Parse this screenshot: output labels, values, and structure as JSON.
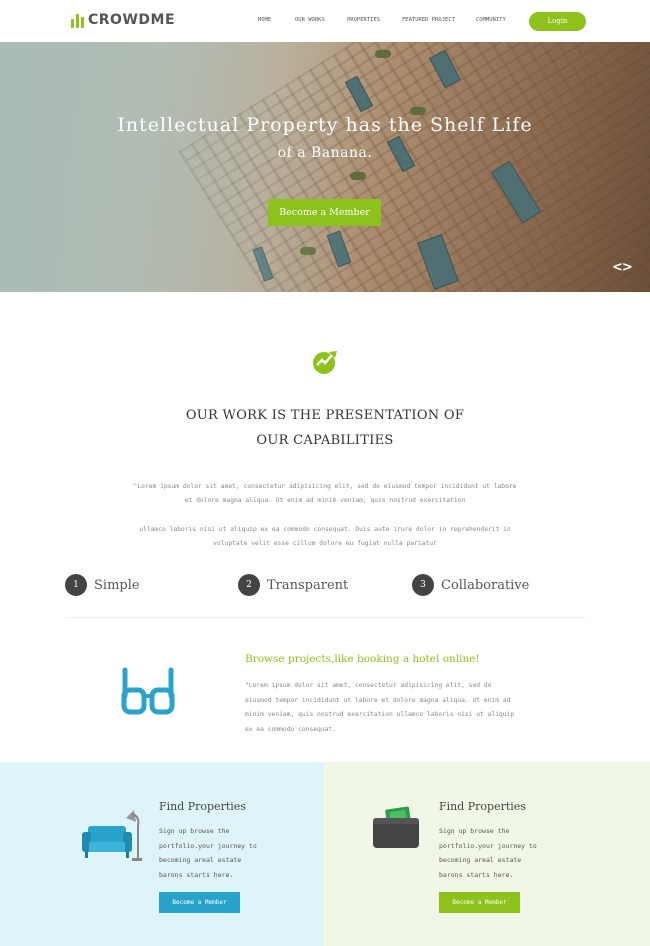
{
  "colors": {
    "accent": "#8cc21b",
    "blue": "#2aa3cc",
    "dark": "#444444"
  },
  "header": {
    "logo_text": "CROWDME",
    "nav": [
      "HOME",
      "OUR WORKS",
      "PROPERTIES",
      "FEATURED PROJECT",
      "COMMUNITY"
    ],
    "login_label": "Login"
  },
  "hero": {
    "title": "Intellectual Property has the Shelf Life",
    "subtitle": "of a Banana.",
    "button_label": "Become a Member",
    "arrows_icon": "slider-arrows-icon"
  },
  "work": {
    "icon": "chart-growth-icon",
    "title_line1": "OUR WORK IS THE PRESENTATION OF",
    "title_line2": "OUR CAPABILITIES",
    "para_lines": [
      "\"Lorem ipsum dolor sit amet, consectetur adipisicing elit, sed do eiusmod tempor incididunt ut labore",
      "et dolore magna aliqua. Ut enim ad minim veniam, quis nostrud exercitation",
      "ullamco laboris nisi ut aliquip ex ea commodo consequat. Duis aute irure dolor in reprehenderit in",
      "voluptate velit esse cillum dolore eu fugiat nulla pariatur"
    ],
    "features": [
      {
        "num": "1",
        "label": "Simple"
      },
      {
        "num": "2",
        "label": "Transparent"
      },
      {
        "num": "3",
        "label": "Collaborative"
      }
    ]
  },
  "browse": {
    "icon": "glasses-icon",
    "title": "Browse projects,like booking a hotel online!",
    "text_lines": [
      "\"Lorem ipsum dolor sit amet, consectetur adipisicing elit, sed do",
      "eiusmod tempor incididunt ut labore et dolore magna aliqua. Ut enim ad",
      "minim veniam, quis nostrud exercitation ullamco laboris nisi ut aliquip",
      "ex ea commodo consequat."
    ]
  },
  "panels": [
    {
      "icon": "sofa-lamp-icon",
      "title": "Find Properties",
      "text_lines": [
        "Sign up browse the",
        "portfolio.your journey to",
        "becoming areal estate",
        "barons starts here."
      ],
      "button_label": "Become a Member"
    },
    {
      "icon": "wallet-icon",
      "title": "Find Properties",
      "text_lines": [
        "Sign up browse the",
        "portfolio.your journey to",
        "becoming areal estate",
        "barons starts here."
      ],
      "button_label": "Become a Member"
    }
  ]
}
